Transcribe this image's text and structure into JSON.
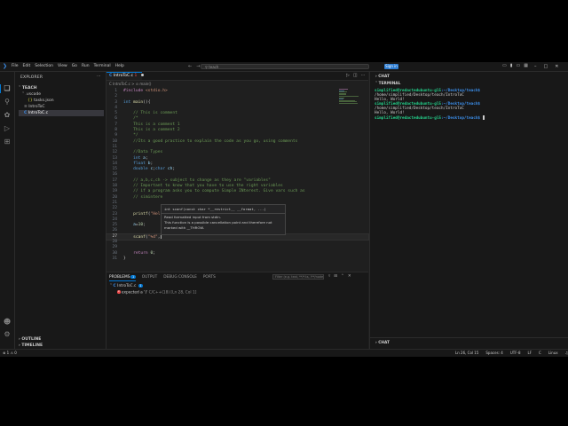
{
  "titlebar": {
    "menu": [
      "File",
      "Edit",
      "Selection",
      "View",
      "Go",
      "Run",
      "Terminal",
      "Help"
    ],
    "back_icon": "arrow-left-icon",
    "forward_icon": "arrow-right-icon",
    "search_placeholder": "teach",
    "signin_label": "Sign in"
  },
  "sidebar": {
    "header": "EXPLORER",
    "folder": "TEACH",
    "items": [
      {
        "label": ".vscode",
        "icon": "chevron-down-icon"
      },
      {
        "label": "tasks.json",
        "icon": "json-icon"
      },
      {
        "label": "IntroToC",
        "icon": "file-icon"
      },
      {
        "label": "IntroToC.c",
        "icon": "c-file-icon"
      }
    ],
    "outline_label": "OUTLINE",
    "timeline_label": "TIMELINE"
  },
  "editor": {
    "tab_label": "IntroToC.c",
    "tab_modified": "1",
    "breadcrumb": "C IntroToC.c > ⊙ main()",
    "lines": [
      {
        "n": "1",
        "t": "#include <stdio.h>"
      },
      {
        "n": "2",
        "t": ""
      },
      {
        "n": "3",
        "t": "int main(){"
      },
      {
        "n": "4",
        "t": ""
      },
      {
        "n": "5",
        "t": "    // This is comment"
      },
      {
        "n": "6",
        "t": "    /*"
      },
      {
        "n": "7",
        "t": "    This is a comment 1"
      },
      {
        "n": "8",
        "t": "    This is a comment 2"
      },
      {
        "n": "9",
        "t": "    */"
      },
      {
        "n": "10",
        "t": "    //Its a good practice to explain the code as you go, using comments"
      },
      {
        "n": "11",
        "t": ""
      },
      {
        "n": "12",
        "t": "    //Data Types"
      },
      {
        "n": "13",
        "t": "    int a;"
      },
      {
        "n": "14",
        "t": "    float b;"
      },
      {
        "n": "15",
        "t": "    double c;char ch;"
      },
      {
        "n": "16",
        "t": ""
      },
      {
        "n": "17",
        "t": "    // a,b,c,ch -> subject to change as they are \"variables\""
      },
      {
        "n": "18",
        "t": "    // Important to know that you have to use the right variables"
      },
      {
        "n": "19",
        "t": "    // if a program asks you to compute Simple INterest. Give vars such as"
      },
      {
        "n": "20",
        "t": "    // simintere"
      },
      {
        "n": "21",
        "t": ""
      },
      {
        "n": "22",
        "t": ""
      },
      {
        "n": "23",
        "t": "    printf(\"Hel"
      },
      {
        "n": "24",
        "t": ""
      },
      {
        "n": "25",
        "t": "    a=10;"
      },
      {
        "n": "26",
        "t": ""
      },
      {
        "n": "27",
        "t": "    scanf(\"%d\","
      },
      {
        "n": "28",
        "t": ""
      },
      {
        "n": "29",
        "t": ""
      },
      {
        "n": "30",
        "t": "    return 0;"
      },
      {
        "n": "31",
        "t": "}"
      }
    ],
    "hover": {
      "signature": "int scanf(const char *__restrict__ __format, ...)",
      "doc1": "Read formatted input from stdin.",
      "doc2": "This function is a possible cancellation point and therefore not marked with __THROW."
    }
  },
  "panel": {
    "tabs": [
      {
        "label": "PROBLEMS",
        "badge": "1"
      },
      {
        "label": "OUTPUT"
      },
      {
        "label": "DEBUG CONSOLE"
      },
      {
        "label": "PORTS"
      }
    ],
    "filter_placeholder": "Filter (e.g. text, **/*.ts, !**/node_modules/**)",
    "file_label": "IntroToC.c",
    "file_count": "1",
    "problem_text": "expected a ')'",
    "problem_src": "C/C++(18)",
    "problem_loc": "[Ln 28, Col 1]"
  },
  "terminal": {
    "chat_label": "CHAT",
    "terminal_label": "TERMINAL",
    "lines": [
      {
        "prompt": "simplified@redactedubuntu-gl5",
        "path": ":~/Desktop/teach$",
        "cmd": " /home/simplified/Desktop/teach/IntroToC"
      },
      {
        "plain": "Hello, World!"
      },
      {
        "prompt": "simplified@redactedubuntu-gl5",
        "path": ":~/Desktop/teach$",
        "cmd": " /home/simplified/Desktop/teach/IntroToC"
      },
      {
        "plain": "Hello, World!"
      },
      {
        "prompt": "simplified@redactedubuntu-gl5",
        "path": ":~/Desktop/teach$",
        "cmd": " "
      }
    ],
    "chat_bottom_label": "CHAT"
  },
  "status": {
    "left": "⊗ 1  ⚠ 0",
    "right": [
      "Ln 26, Col 15",
      "Spaces: 4",
      "UTF-8",
      "LF",
      "C",
      "Linux"
    ]
  }
}
